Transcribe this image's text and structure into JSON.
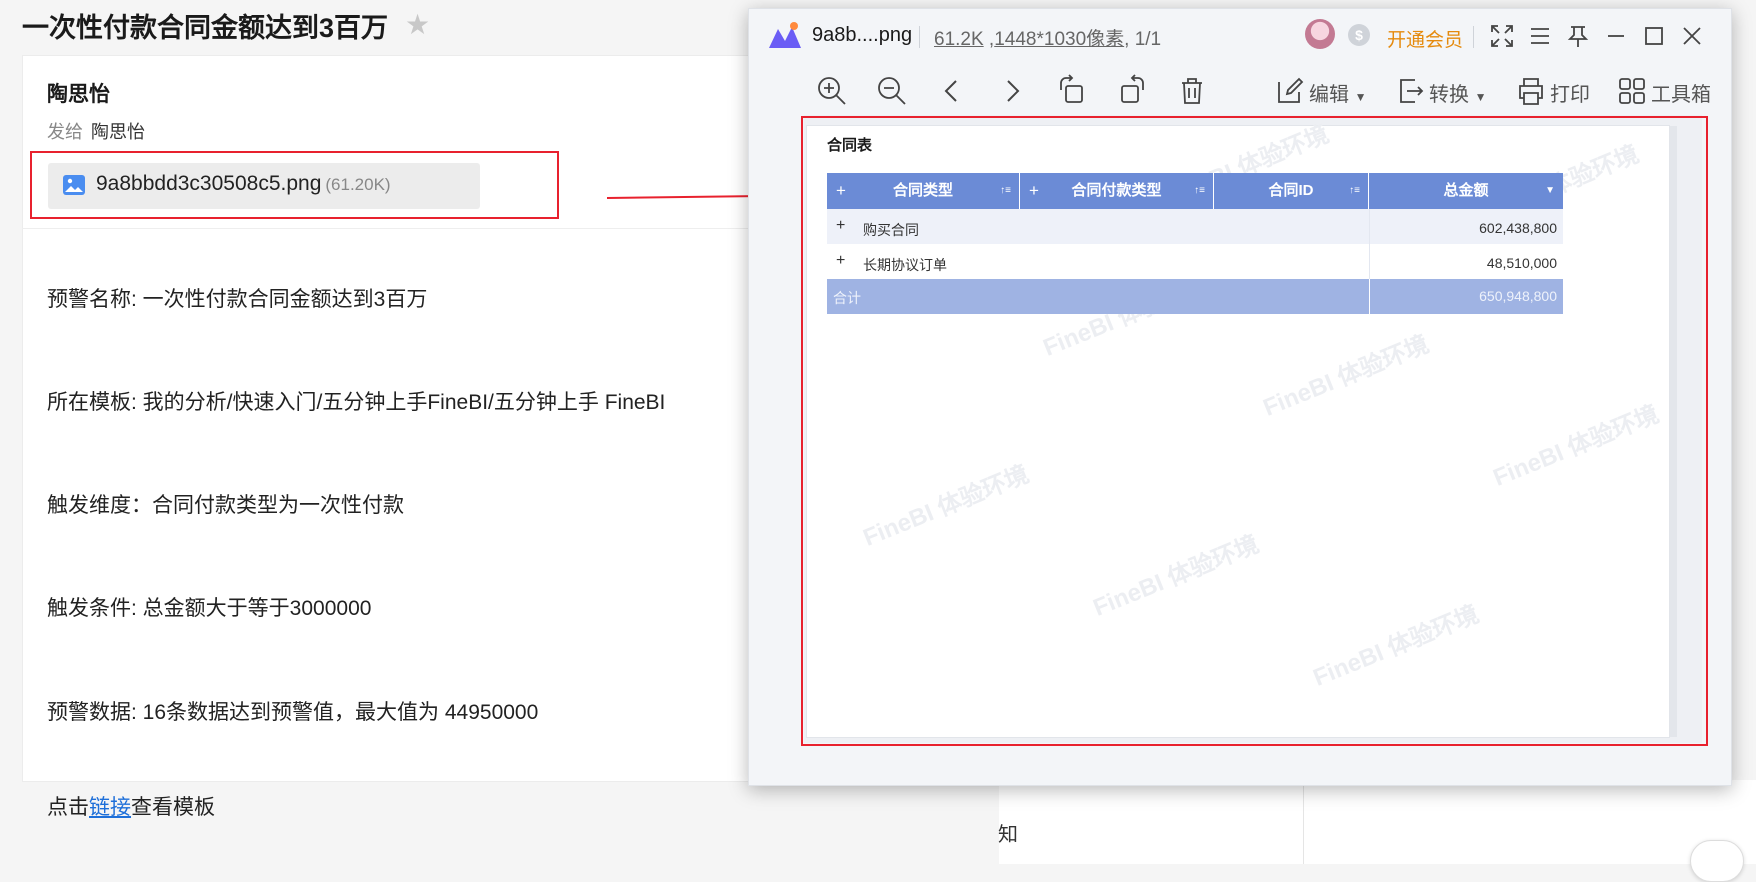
{
  "mail": {
    "title": "一次性付款合同金额达到3百万",
    "sender": "陶思怡",
    "to_label": "发给",
    "to_name": "陶思怡",
    "attachment": {
      "name": "9a8bbdd3c30508c5.png",
      "size": "(61.20K)"
    },
    "lines": {
      "alert_name": "预警名称: 一次性付款合同金额达到3百万",
      "template": "所在模板: 我的分析/快速入门/五分钟上手FineBI/五分钟上手 FineBI",
      "dimension": "触发维度：合同付款类型为一次性付款",
      "condition": "触发条件: 总金额大于等于3000000",
      "data": "预警数据: 16条数据达到预警值，最大值为 44950000",
      "link_prefix": "点击",
      "link_text": "链接",
      "link_suffix": "查看模板"
    },
    "bottom_text": "知"
  },
  "viewer": {
    "filename": "9a8b....png",
    "meta": {
      "size": "61.2K",
      "dims": "1448*1030像素",
      "pages": ", 1/1"
    },
    "vip_label": "开通会员",
    "coin_label": "$",
    "tools": {
      "edit": "编辑",
      "convert": "转换",
      "print": "打印",
      "toolbox": "工具箱"
    },
    "table": {
      "title": "合同表",
      "headers": [
        "合同类型",
        "合同付款类型",
        "合同ID",
        "总金额"
      ],
      "rows": [
        {
          "label": "购买合同",
          "amount": "602,438,800"
        },
        {
          "label": "长期协议订单",
          "amount": "48,510,000"
        }
      ],
      "total": {
        "label": "合计",
        "amount": "650,948,800"
      }
    },
    "watermark": "FineBI 体验环境"
  },
  "colors": {
    "highlight": "#e8212e",
    "header": "#6b8bd6",
    "total_row": "#9fb3e3",
    "vip": "#e58a0d",
    "link": "#1e6fd9"
  }
}
